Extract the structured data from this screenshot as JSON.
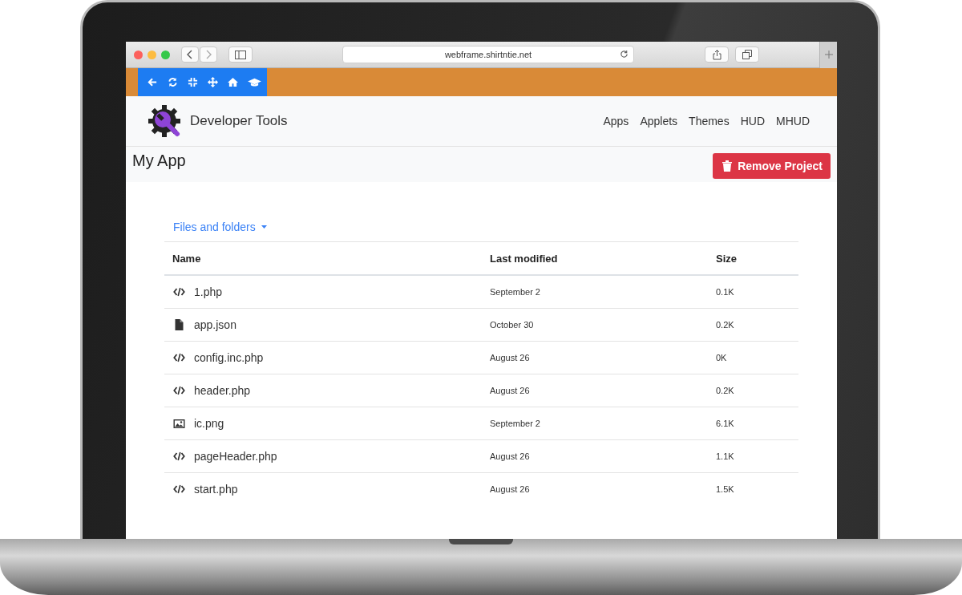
{
  "browser": {
    "url": "webframe.shirtntie.net"
  },
  "header": {
    "brand": "Developer Tools",
    "nav": [
      "Apps",
      "Applets",
      "Themes",
      "HUD",
      "MHUD"
    ]
  },
  "page": {
    "title": "My App",
    "action": "Remove Project"
  },
  "files": {
    "dropdown": "Files and folders",
    "columns": [
      "Name",
      "Last modified",
      "Size"
    ],
    "rows": [
      {
        "kind": "code",
        "name": "1.php",
        "modified": "September 2",
        "size": "0.1K"
      },
      {
        "kind": "file",
        "name": "app.json",
        "modified": "October 30",
        "size": "0.2K"
      },
      {
        "kind": "code",
        "name": "config.inc.php",
        "modified": "August 26",
        "size": "0K"
      },
      {
        "kind": "code",
        "name": "header.php",
        "modified": "August 26",
        "size": "0.2K"
      },
      {
        "kind": "image",
        "name": "ic.png",
        "modified": "September 2",
        "size": "6.1K"
      },
      {
        "kind": "code",
        "name": "pageHeader.php",
        "modified": "August 26",
        "size": "1.1K"
      },
      {
        "kind": "code",
        "name": "start.php",
        "modified": "August 26",
        "size": "1.5K"
      }
    ]
  }
}
